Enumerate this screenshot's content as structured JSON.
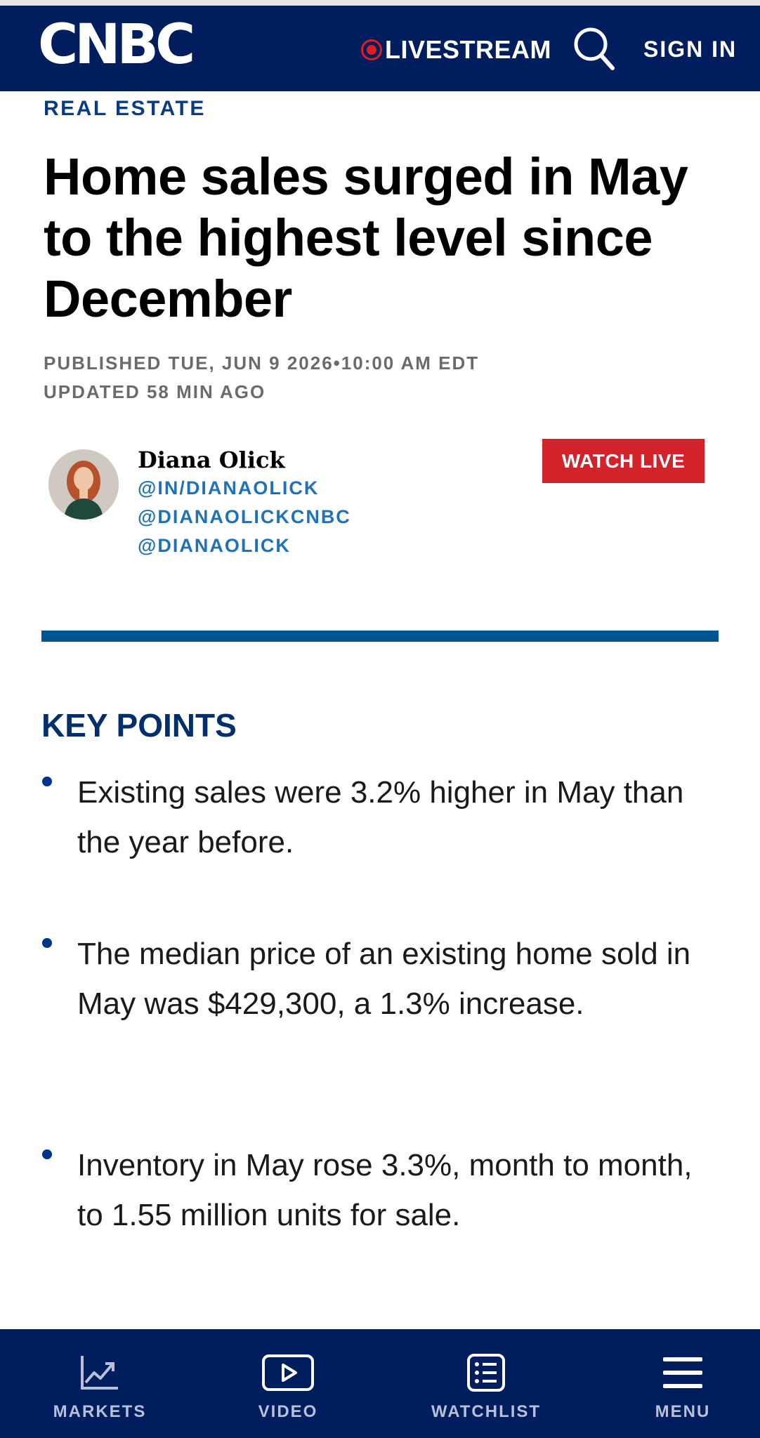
{
  "header": {
    "logo": "CNBC",
    "livestream": "LIVESTREAM",
    "sign_in": "SIGN IN"
  },
  "article": {
    "section": "REAL ESTATE",
    "headline": "Home sales surged in May to the highest level since December",
    "published": "PUBLISHED TUE, JUN 9 2026•10:00 AM EDT",
    "updated": "UPDATED 58 MIN AGO"
  },
  "author": {
    "name": "Diana Olick",
    "handles": [
      "@IN/DIANAOLICK",
      "@DIANAOLICKCNBC",
      "@DIANAOLICK"
    ]
  },
  "watch_live": "WATCH LIVE",
  "key_points": {
    "title": "KEY POINTS",
    "items": [
      "Existing sales were 3.2% higher in May than the year before.",
      "The median price of an existing home sold in May was $429,300, a 1.3% increase.",
      "Inventory in May rose 3.3%, month to month, to 1.55 million units for sale."
    ]
  },
  "bottom_nav": {
    "items": [
      {
        "label": "MARKETS",
        "icon": "chart-icon"
      },
      {
        "label": "VIDEO",
        "icon": "play-icon"
      },
      {
        "label": "WATCHLIST",
        "icon": "list-icon"
      },
      {
        "label": "MENU",
        "icon": "hamburger-icon"
      }
    ]
  },
  "colors": {
    "navy": "#001e5e",
    "live_red": "#e01b24",
    "watch_red": "#d2232a",
    "link_blue": "#1f72b8",
    "divider_blue": "#005594"
  }
}
